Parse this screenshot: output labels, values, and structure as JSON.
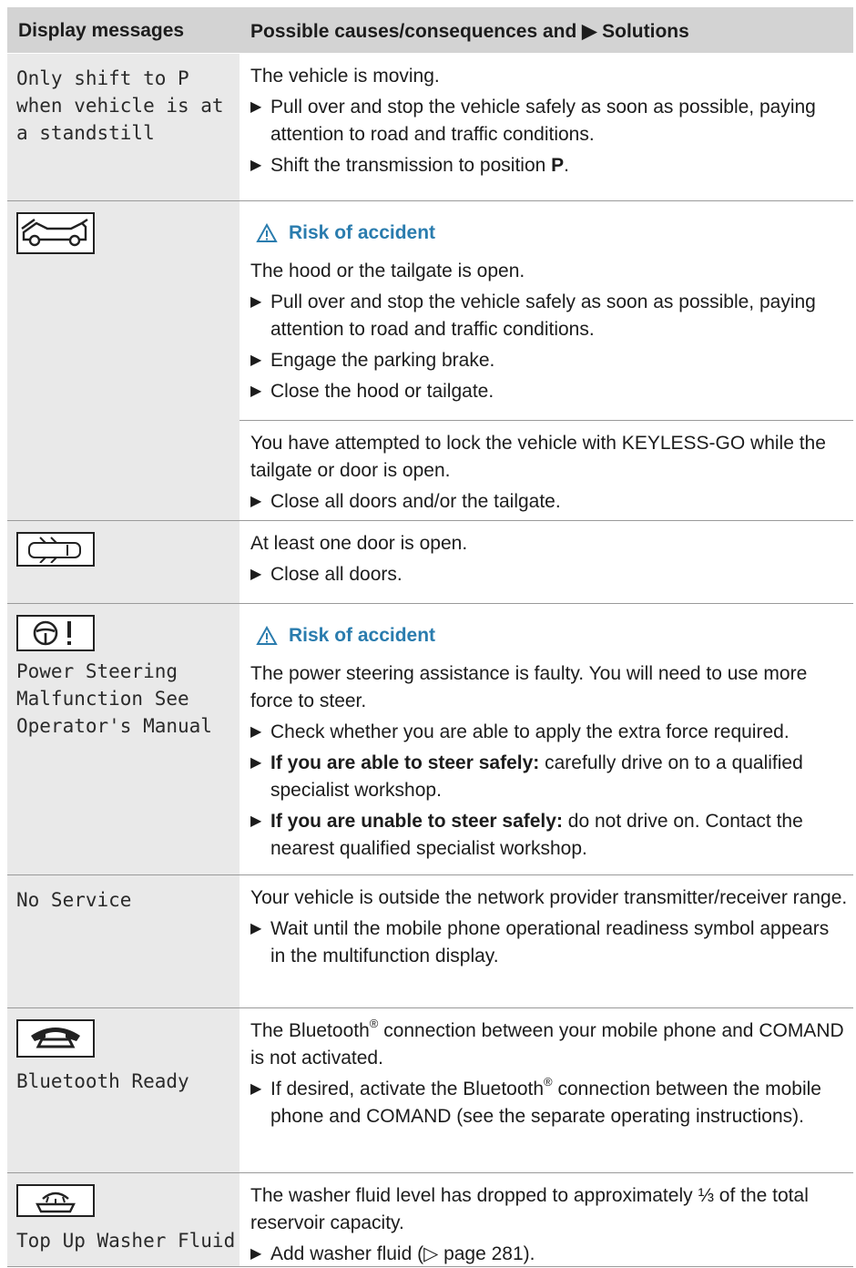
{
  "header": {
    "col1": "Display messages",
    "col2": "Possible causes/consequences and ▶ Solutions"
  },
  "row1": {
    "message": "Only shift to P\nwhen vehicle is at\na standstill",
    "cause": "The vehicle is moving.",
    "bullets": [
      "Pull over and stop the vehicle safely as soon as possible, paying attention to road and traffic conditions.",
      "Shift the transmission to position "
    ],
    "bold_p": "P",
    "period": "."
  },
  "row2": {
    "icon": "hood-tailgate-open-icon",
    "warning": "Risk of accident",
    "cause": "The hood or the tailgate is open.",
    "bullets": [
      "Pull over and stop the vehicle safely as soon as possible, paying attention to road and traffic conditions.",
      "Engage the parking brake.",
      "Close the hood or tailgate."
    ],
    "cause2": "You have attempted to lock the vehicle with KEYLESS-GO while the tailgate or door is open.",
    "bullet2": "Close all doors and/or the tailgate."
  },
  "row3": {
    "icon": "door-open-icon",
    "cause": "At least one door is open.",
    "bullet": "Close all doors."
  },
  "row4": {
    "icon": "steering-wheel-warning-icon",
    "message": "Power Steering\nMalfunction See\nOperator's Manual",
    "warning": "Risk of accident",
    "cause": "The power steering assistance is faulty. You will need to use more force to steer.",
    "bullet1": "Check whether you are able to apply the extra force required.",
    "bullet2_bold": "If you are able to steer safely:",
    "bullet2": " carefully drive on to a qualified specialist workshop.",
    "bullet3_bold": "If you are unable to steer safely:",
    "bullet3": " do not drive on. Contact the nearest qualified specialist workshop."
  },
  "row5": {
    "message": "No Service",
    "cause": "Your vehicle is outside the network provider transmitter/receiver range.",
    "bullet": "Wait until the mobile phone operational readiness symbol appears in the multifunction display."
  },
  "row6": {
    "icon": "telephone-icon",
    "message": "Bluetooth Ready",
    "cause_a": "The Bluetooth",
    "reg": "®",
    "cause_b": " connection between your mobile phone and COMAND is not activated.",
    "bullet_a": "If desired, activate the Bluetooth",
    "bullet_b": " connection between the mobile phone and COMAND (see the separate operating instructions)."
  },
  "row7": {
    "icon": "washer-fluid-icon",
    "message": "Top Up Washer Fluid",
    "cause": "The washer fluid level has dropped to approximately ⅓ of the total reservoir capacity.",
    "bullet": "Add washer fluid (▷ page 281)."
  },
  "bullet_marker": "▶",
  "warning_icon": "warning-triangle-icon"
}
